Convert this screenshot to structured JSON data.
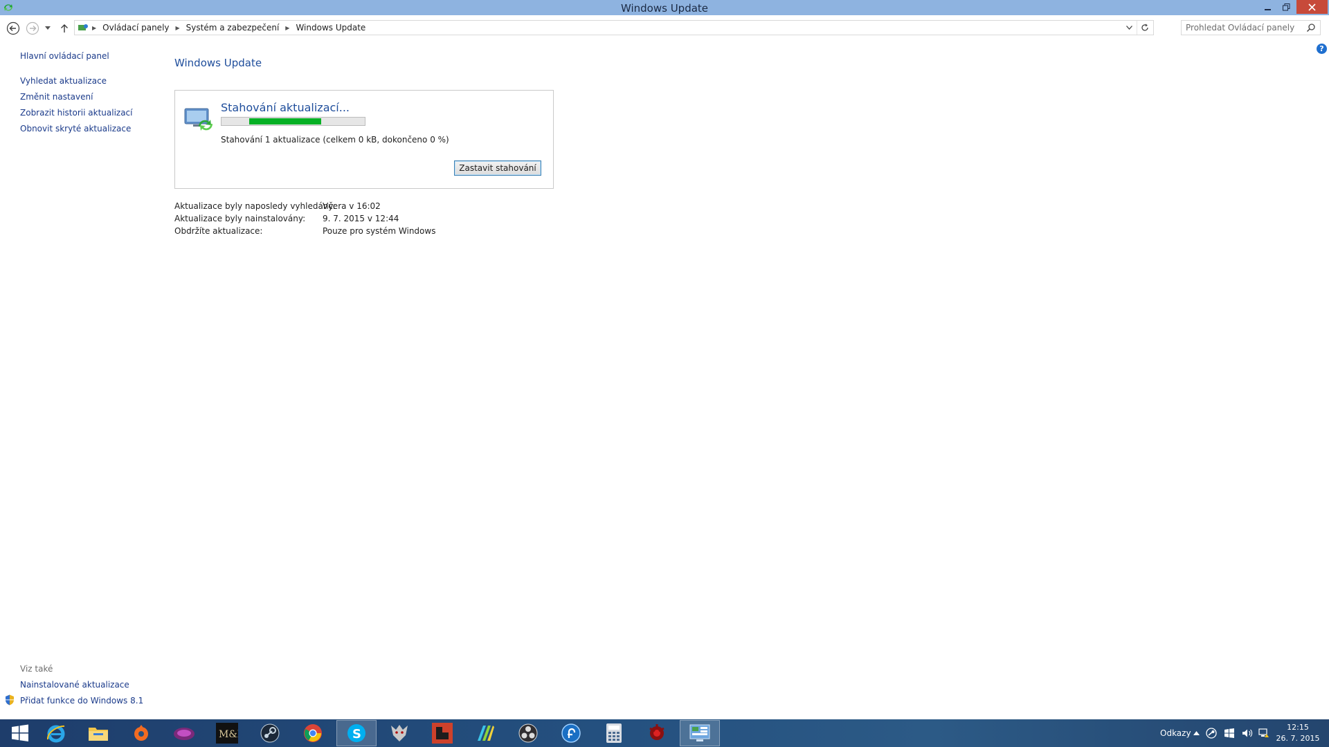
{
  "window": {
    "title": "Windows Update"
  },
  "breadcrumb": [
    "Ovládací panely",
    "Systém a zabezpečení",
    "Windows Update"
  ],
  "search": {
    "placeholder": "Prohledat Ovládací panely"
  },
  "leftnav": {
    "home": "Hlavní ovládací panel",
    "items": [
      "Vyhledat aktualizace",
      "Změnit nastavení",
      "Zobrazit historii aktualizací",
      "Obnovit skryté aktualizace"
    ]
  },
  "main": {
    "title": "Windows Update",
    "status_title": "Stahování aktualizací...",
    "status_text": "Stahování 1 aktualizace (celkem 0 kB, dokončeno 0 %)",
    "progress_fraction": 0.5,
    "stop_button": "Zastavit stahování",
    "info": [
      {
        "label": "Aktualizace byly naposledy vyhledány:",
        "value": "Včera v 16:02"
      },
      {
        "label": "Aktualizace byly nainstalovány:",
        "value": "9. 7. 2015 v 12:44"
      },
      {
        "label": "Obdržíte aktualizace:",
        "value": "Pouze pro systém Windows"
      }
    ]
  },
  "see_also": {
    "label": "Viz také",
    "links": [
      "Nainstalované aktualizace",
      "Přidat funkce do Windows 8.1"
    ]
  },
  "taskbar": {
    "apps": [
      "start-button",
      "internet-explorer-icon",
      "file-explorer-icon",
      "origin-icon",
      "game-icon",
      "mount-and-blade-icon",
      "steam-icon",
      "chrome-icon",
      "skype-icon",
      "witcher-icon",
      "rust-icon",
      "app-icon",
      "obs-icon",
      "app-icon",
      "calculator-icon",
      "game-icon",
      "control-panel-icon"
    ],
    "toolbar_label": "Odkazy",
    "time": "12:15",
    "date": "26. 7. 2015"
  },
  "colors": {
    "accent": "#1e4d9b",
    "link": "#1a3a8a",
    "progress": "#06b025",
    "titlebar": "#8eb3e0"
  }
}
